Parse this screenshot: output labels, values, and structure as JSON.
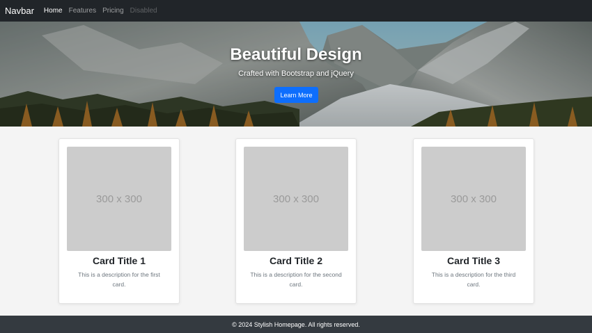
{
  "navbar": {
    "brand": "Navbar",
    "links": [
      {
        "label": "Home",
        "state": "active"
      },
      {
        "label": "Features",
        "state": "normal"
      },
      {
        "label": "Pricing",
        "state": "normal"
      },
      {
        "label": "Disabled",
        "state": "disabled"
      }
    ]
  },
  "hero": {
    "title": "Beautiful Design",
    "subtitle": "Crafted with Bootstrap and jQuery",
    "button_label": "Learn More"
  },
  "cards": [
    {
      "image_text": "300 x 300",
      "title": "Card Title 1",
      "text": "This is a description for the first card."
    },
    {
      "image_text": "300 x 300",
      "title": "Card Title 2",
      "text": "This is a description for the second card."
    },
    {
      "image_text": "300 x 300",
      "title": "Card Title 3",
      "text": "This is a description for the third card."
    }
  ],
  "footer": {
    "text": "© 2024 Stylish Homepage. All rights reserved."
  },
  "colors": {
    "navbar_bg": "#212529",
    "footer_bg": "#343a40",
    "primary": "#0d6efd",
    "page_bg": "#f4f4f4"
  }
}
